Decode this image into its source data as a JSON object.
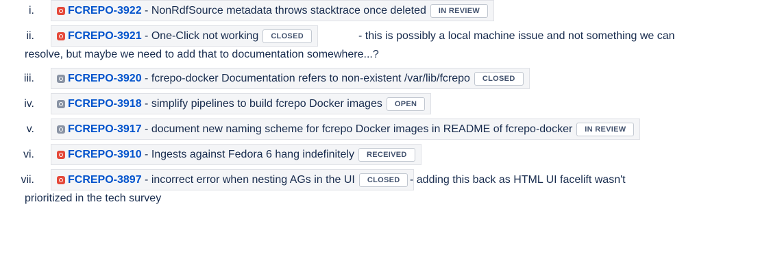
{
  "items": [
    {
      "numeral": "i.",
      "key": "FCREPO-3922",
      "summary": " - NonRdfSource metadata throws stacktrace once deleted",
      "status": "IN REVIEW",
      "priority_color": "red"
    },
    {
      "numeral": "ii.",
      "key": "FCREPO-3921",
      "summary": " - One-Click not working",
      "status": "CLOSED",
      "priority_color": "red",
      "trailing": " - this is possibly a local machine issue and not something we can",
      "continuation": "resolve, but maybe we need to add that to documentation somewhere...?"
    },
    {
      "numeral": "iii.",
      "key": "FCREPO-3920",
      "summary": " - fcrepo-docker Documentation refers to non-existent /var/lib/fcrepo",
      "status": "CLOSED",
      "priority_color": "grey"
    },
    {
      "numeral": "iv.",
      "key": "FCREPO-3918",
      "summary": " - simplify pipelines to build fcrepo Docker images",
      "status": "OPEN",
      "priority_color": "grey"
    },
    {
      "numeral": "v.",
      "key": "FCREPO-3917",
      "summary": " - document new naming scheme for fcrepo Docker images in README of fcrepo-docker",
      "status": "IN REVIEW",
      "priority_color": "grey"
    },
    {
      "numeral": "vi.",
      "key": "FCREPO-3910",
      "summary": " - Ingests against Fedora 6 hang indefinitely",
      "status": "RECEIVED",
      "priority_color": "red"
    },
    {
      "numeral": "vii.",
      "key": "FCREPO-3897",
      "summary": " - incorrect error when nesting AGs in the UI",
      "status": "CLOSED",
      "priority_color": "red",
      "trailing": " - adding this back as HTML UI facelift wasn't",
      "continuation": "prioritized in the tech survey"
    }
  ],
  "colors": {
    "red": "#e5493a",
    "grey": "#8993a4",
    "link": "#0052cc"
  }
}
